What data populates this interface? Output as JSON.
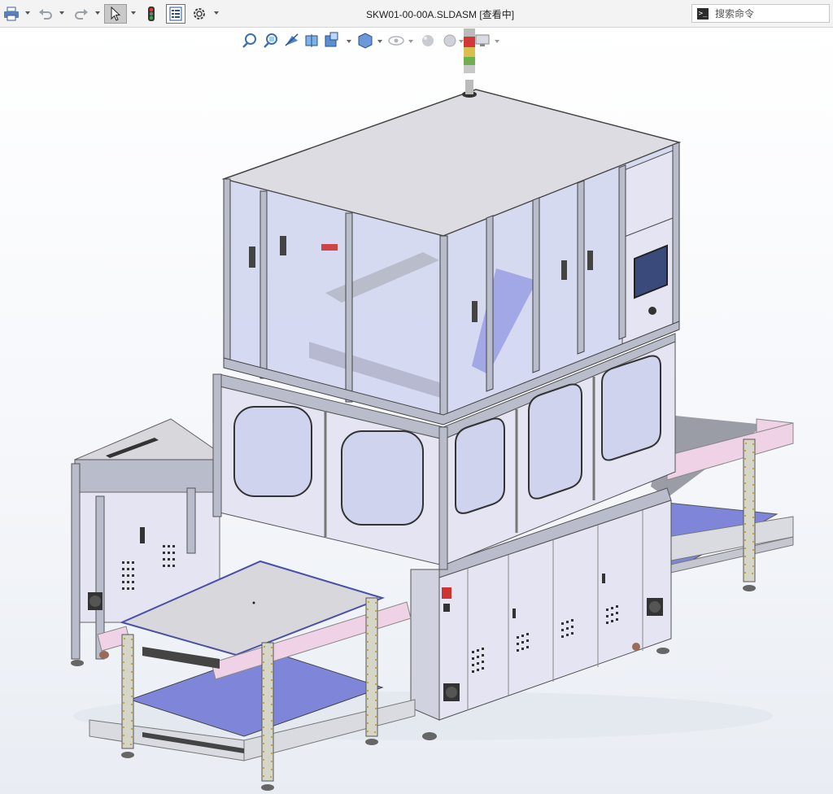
{
  "window": {
    "title": "SKW01-00-00A.SLDASM [查看中]"
  },
  "toolbar": {
    "buttons": [
      {
        "name": "print",
        "icon": "printer-icon"
      },
      {
        "name": "undo",
        "icon": "undo-icon"
      },
      {
        "name": "redo",
        "icon": "redo-icon"
      },
      {
        "name": "select",
        "icon": "cursor-icon"
      },
      {
        "name": "rebuild",
        "icon": "traffic-light-icon"
      },
      {
        "name": "file-properties",
        "icon": "list-icon"
      },
      {
        "name": "options",
        "icon": "gear-icon"
      }
    ]
  },
  "search": {
    "placeholder": "搜索命令"
  },
  "view_toolbar": {
    "icons": [
      "zoom-to-fit-icon",
      "zoom-area-icon",
      "previous-view-icon",
      "section-view-icon",
      "view-orientation-icon",
      "display-style-icon",
      "hide-show-icon",
      "appearance-icon",
      "scene-icon",
      "view-settings-icon"
    ]
  },
  "colors": {
    "frame": "#b9bccb",
    "panel": "#e4e4f3",
    "glass": "#cfd3ee",
    "tray": "#7f86d9",
    "top": "#dcdce2",
    "rail_pink": "#efd2e6",
    "rail": "#d9dbe1"
  }
}
